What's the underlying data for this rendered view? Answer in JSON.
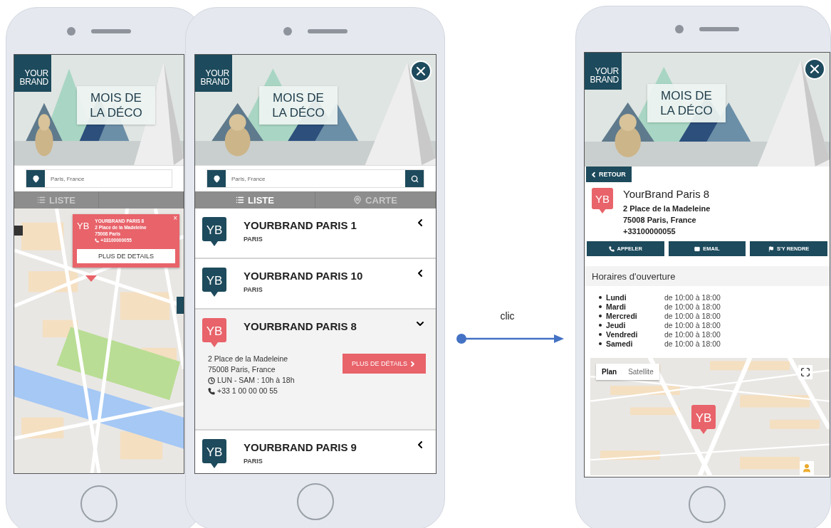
{
  "phones": [
    {
      "kind": "map",
      "banner": {
        "logo": [
          "YOUR",
          "BRAND"
        ],
        "headline": [
          "MOIS DE",
          "LA DÉCO"
        ],
        "close": false
      },
      "search": {
        "value": "Paris, France",
        "button": false
      },
      "tabs": [
        {
          "label": "LISTE",
          "selected": false
        }
      ],
      "popup": {
        "badge": "YB",
        "name": "YOURBRAND PARIS 8",
        "lines": [
          "2 Place de la Madeleine",
          "75008 Paris"
        ],
        "phone": "+33100000055",
        "button": "PLUS DE DETAILS",
        "close": "×"
      }
    },
    {
      "kind": "list",
      "banner": {
        "logo": [
          "YOUR",
          "BRAND"
        ],
        "headline": [
          "MOIS DE",
          "LA DÉCO"
        ],
        "close": true
      },
      "search": {
        "value": "Paris, France",
        "button": true
      },
      "tabs": [
        {
          "label": "LISTE",
          "selected": true
        },
        {
          "label": "CARTE",
          "selected": false
        }
      ],
      "stores": [
        {
          "badge": "YB",
          "name": "YOURBRAND PARIS 1",
          "city": "PARIS",
          "expanded": false,
          "color": "#1d4a5c"
        },
        {
          "badge": "YB",
          "name": "YOURBRAND PARIS 10",
          "city": "PARIS",
          "expanded": false,
          "color": "#1d4a5c"
        },
        {
          "badge": "YB",
          "name": "YOURBRAND PARIS 8",
          "expanded": true,
          "color": "#e8636a",
          "address": [
            "2 Place de la Madeleine",
            "75008 Paris, France"
          ],
          "hours": "LUN - SAM : 10h à 18h",
          "phone": "+33 1 00 00 00 55",
          "button": "PLUS DE DÉTAILS"
        },
        {
          "badge": "YB",
          "name": "YOURBRAND PARIS 9",
          "city": "PARIS",
          "expanded": false,
          "color": "#1d4a5c"
        }
      ]
    },
    {
      "kind": "detail",
      "banner": {
        "logo": [
          "YOUR",
          "BRAND"
        ],
        "headline": [
          "MOIS DE",
          "LA DÉCO"
        ],
        "close": true
      },
      "back": "RETOUR",
      "store": {
        "badge": "YB",
        "name": "YourBrand Paris 8",
        "lines": [
          "2 Place de la Madeleine",
          "75008 Paris, France",
          "+33100000055"
        ]
      },
      "actions": [
        {
          "label": "APPELER"
        },
        {
          "label": "EMAIL"
        },
        {
          "label": "S'Y RENDRE"
        }
      ],
      "hours": {
        "title": "Horaires d'ouverture",
        "days": [
          {
            "day": "Lundi",
            "time": "de 10:00 à 18:00"
          },
          {
            "day": "Mardi",
            "time": "de 10:00 à 18:00"
          },
          {
            "day": "Mercredi",
            "time": "de 10:00 à 18:00"
          },
          {
            "day": "Jeudi",
            "time": "de 10:00 à 18:00"
          },
          {
            "day": "Vendredi",
            "time": "de 10:00 à 18:00"
          },
          {
            "day": "Samedi",
            "time": "de 10:00 à 18:00"
          }
        ]
      },
      "map": {
        "modes": [
          {
            "label": "Plan",
            "selected": true
          },
          {
            "label": "Satellite",
            "selected": false
          }
        ],
        "pin": "YB"
      }
    }
  ],
  "arrow": {
    "label": "clic"
  }
}
